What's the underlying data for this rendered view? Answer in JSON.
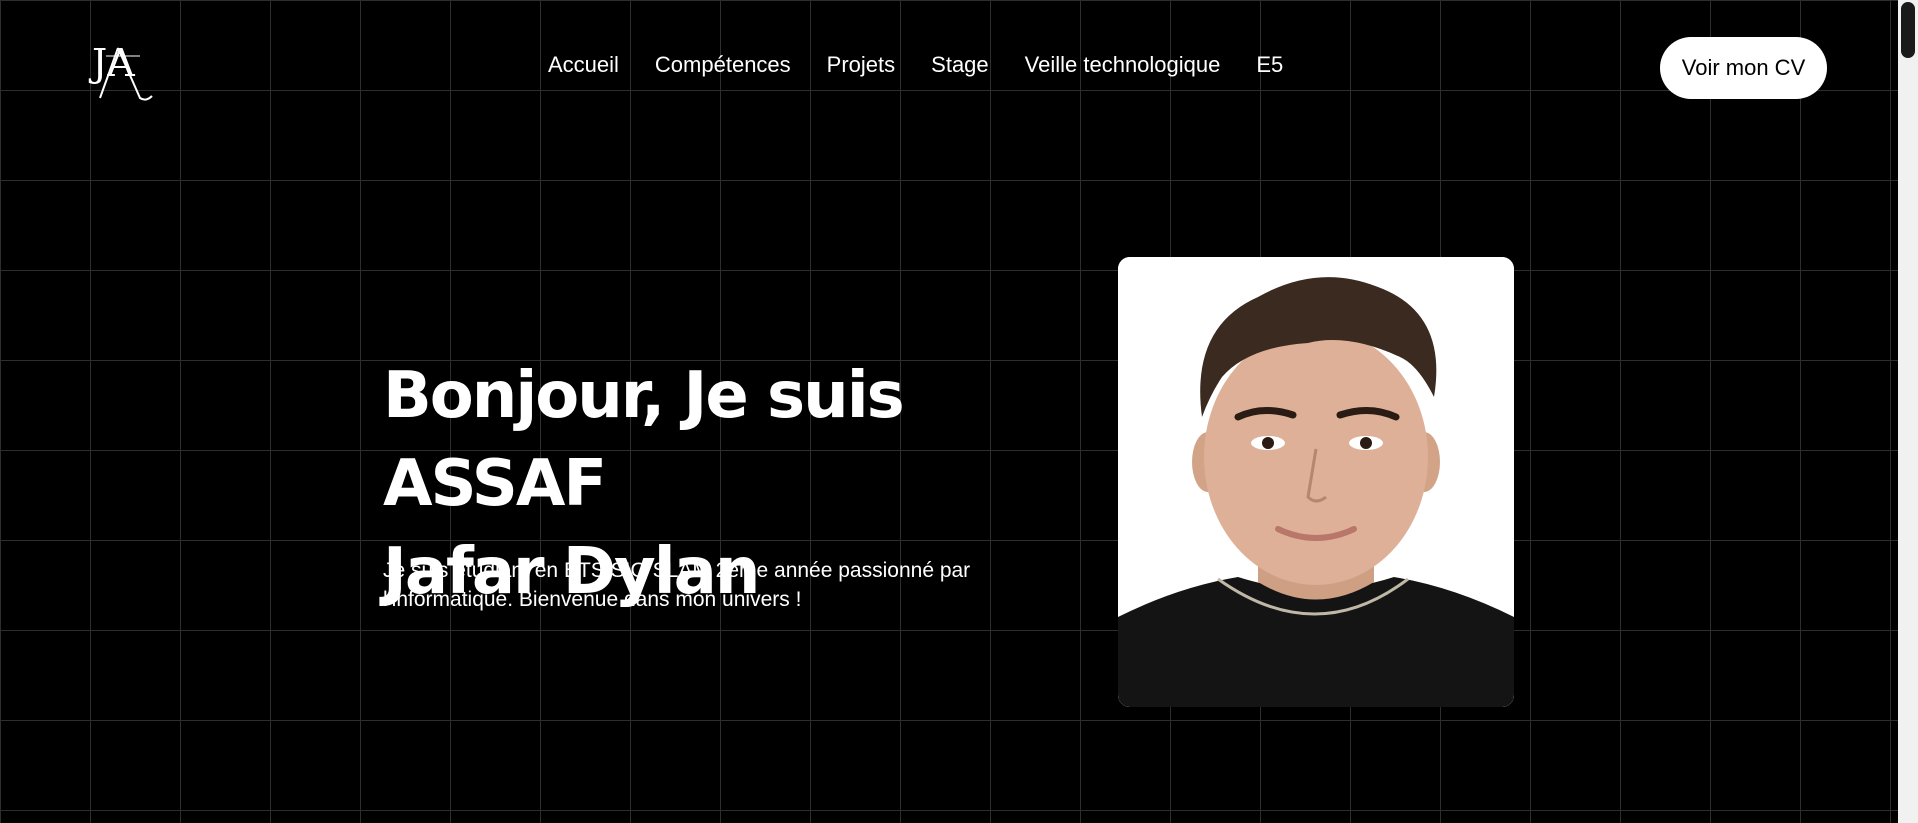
{
  "logo": {
    "text": "JA",
    "icon": "monogram-logo-icon"
  },
  "nav": {
    "items": [
      {
        "label": "Accueil"
      },
      {
        "label": "Compétences"
      },
      {
        "label": "Projets"
      },
      {
        "label": "Stage"
      },
      {
        "label": "Veille technologique"
      },
      {
        "label": "E5"
      }
    ]
  },
  "header": {
    "cv_button_label": "Voir mon CV"
  },
  "hero": {
    "title_line1": "Bonjour, Je suis ASSAF",
    "title_line2": "Jafar Dylan",
    "description": "Je suis étudiant en BTS SIO SLAM 2eme année passionné par l'informatique. Bienvenue dans mon univers !",
    "photo_alt": "Portrait photo"
  },
  "colors": {
    "background": "#000000",
    "grid": "#2e2e2e",
    "text": "#ffffff",
    "button_bg": "#ffffff",
    "button_text": "#000000"
  }
}
